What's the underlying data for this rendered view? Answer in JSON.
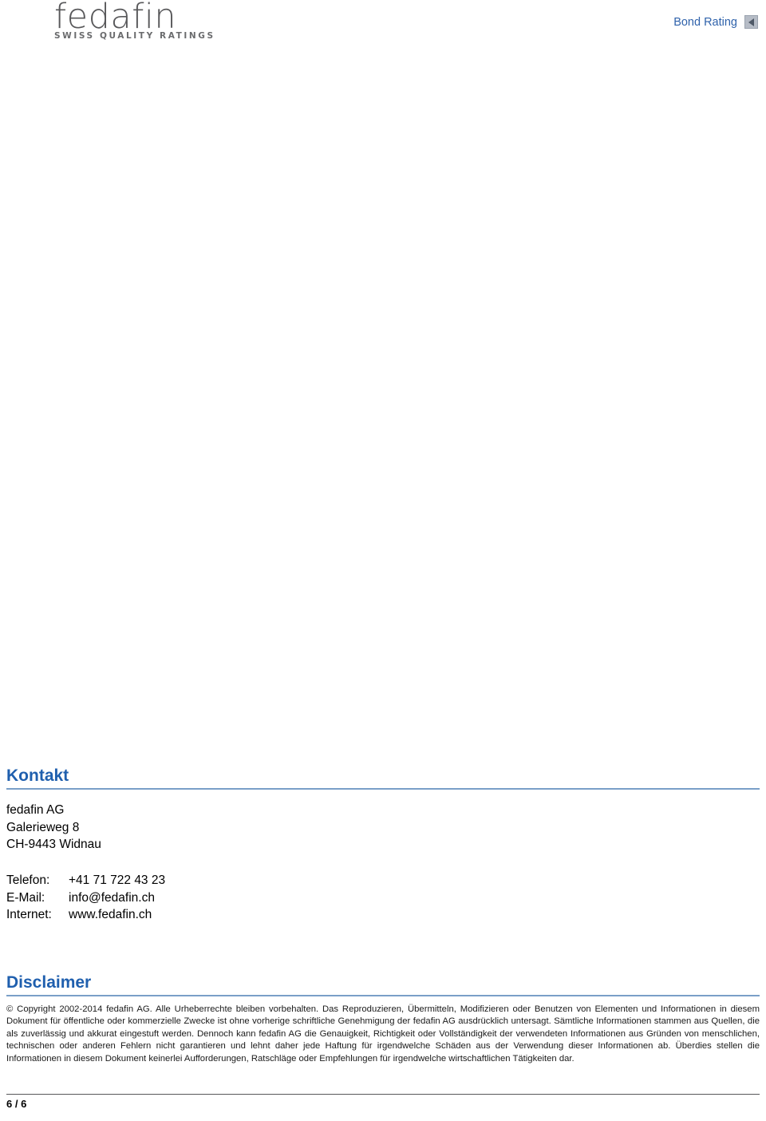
{
  "header": {
    "logo": {
      "wordmark": "fedafin",
      "tagline": "SWISS QUALITY RATINGS",
      "grid_colors": [
        [
          "#b9c8e0",
          "#a9bcd8",
          "#b3c3dc"
        ],
        [
          "#6d93c8",
          "#6b92c7",
          "#b0b2b5"
        ],
        [
          "#1b6cb0",
          "#bcbec1",
          "#bcbec1"
        ]
      ]
    },
    "doc_type_label": "Bond Rating",
    "nav_prev_icon": "triangle-left-icon",
    "accent_color": "#2f62ab"
  },
  "sections": {
    "kontakt": {
      "heading": "Kontakt",
      "company": "fedafin AG",
      "street": "Galerieweg 8",
      "city": "CH-9443 Widnau",
      "rows": [
        {
          "label": "Telefon:",
          "value": "+41 71 722 43 23"
        },
        {
          "label": "E-Mail:",
          "value": "info@fedafin.ch"
        },
        {
          "label": "Internet:",
          "value": "www.fedafin.ch"
        }
      ]
    },
    "disclaimer": {
      "heading": "Disclaimer",
      "body": "© Copyright 2002-2014 fedafin AG. Alle Urheberrechte bleiben vorbehalten. Das Reproduzieren, Übermitteln, Modifizieren oder Benutzen von Elementen und Informationen in diesem Dokument für öffentliche oder kommerzielle Zwecke ist ohne vorherige schriftliche Genehmigung der fedafin AG ausdrücklich untersagt. Sämtliche Informationen stammen aus Quellen, die als zuverlässig und akkurat eingestuft werden. Dennoch kann fedafin AG die Genauigkeit, Richtigkeit oder Vollständigkeit der verwendeten Informationen aus Gründen von menschlichen, technischen oder anderen Fehlern nicht garantieren und lehnt daher jede Haftung für irgendwelche Schäden aus der Verwendung dieser Informationen ab. Überdies stellen die Informationen in diesem Dokument keinerlei Aufforderungen, Ratschläge oder Empfehlungen für irgendwelche wirtschaftlichen Tätigkeiten dar."
    }
  },
  "footer": {
    "page_number": "6 / 6"
  }
}
